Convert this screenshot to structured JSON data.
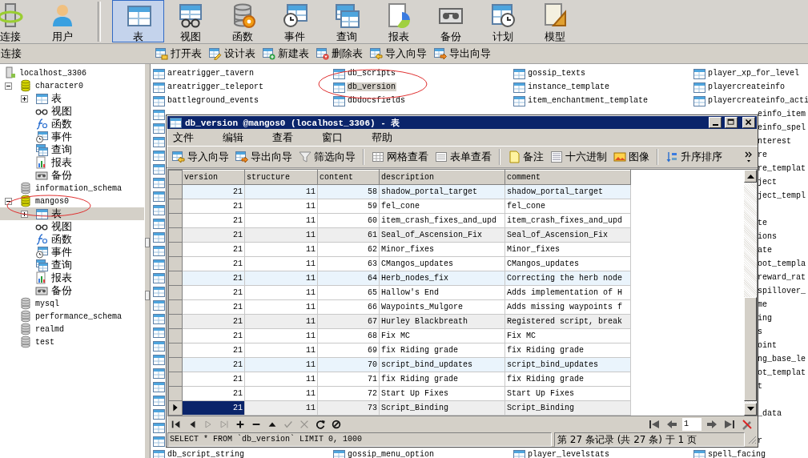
{
  "toolbar": [
    [
      {
        "label": "连接",
        "kind": "connection",
        "selected": false
      },
      {
        "label": "用户",
        "kind": "user",
        "selected": false
      }
    ],
    [
      {
        "label": "表",
        "kind": "table",
        "selected": true
      },
      {
        "label": "视图",
        "kind": "view",
        "selected": false
      },
      {
        "label": "函数",
        "kind": "function",
        "selected": false
      },
      {
        "label": "事件",
        "kind": "event",
        "selected": false
      },
      {
        "label": "查询",
        "kind": "query",
        "selected": false
      },
      {
        "label": "报表",
        "kind": "report",
        "selected": false
      },
      {
        "label": "备份",
        "kind": "backup",
        "selected": false
      },
      {
        "label": "计划",
        "kind": "schedule",
        "selected": false
      },
      {
        "label": "模型",
        "kind": "model",
        "selected": false
      }
    ]
  ],
  "panel_title": "连接",
  "actions": [
    {
      "label": "打开表",
      "kind": "open"
    },
    {
      "label": "设计表",
      "kind": "design"
    },
    {
      "label": "新建表",
      "kind": "new"
    },
    {
      "label": "删除表",
      "kind": "delete"
    },
    {
      "label": "导入向导",
      "kind": "import"
    },
    {
      "label": "导出向导",
      "kind": "export"
    }
  ],
  "tree": [
    {
      "label": "localhost_3306",
      "kind": "server",
      "selected": false,
      "children": [
        {
          "label": "character0",
          "kind": "database",
          "expanded": true,
          "selected": false,
          "children": [
            {
              "label": "表",
              "kind": "tables",
              "expanded": false,
              "selected": false
            },
            {
              "label": "视图",
              "kind": "views",
              "selected": false
            },
            {
              "label": "函数",
              "kind": "functions",
              "selected": false
            },
            {
              "label": "事件",
              "kind": "events",
              "selected": false
            },
            {
              "label": "查询",
              "kind": "queries",
              "selected": false
            },
            {
              "label": "报表",
              "kind": "reports",
              "selected": false
            },
            {
              "label": "备份",
              "kind": "backups",
              "selected": false
            }
          ]
        },
        {
          "label": "information_schema",
          "kind": "database",
          "selected": false
        },
        {
          "label": "mangos0",
          "kind": "database",
          "expanded": true,
          "selected": false,
          "children": [
            {
              "label": "表",
              "kind": "tables",
              "expanded": false,
              "selected": true
            },
            {
              "label": "视图",
              "kind": "views",
              "selected": false
            },
            {
              "label": "函数",
              "kind": "functions",
              "selected": false
            },
            {
              "label": "事件",
              "kind": "events",
              "selected": false
            },
            {
              "label": "查询",
              "kind": "queries",
              "selected": false
            },
            {
              "label": "报表",
              "kind": "reports",
              "selected": false
            },
            {
              "label": "备份",
              "kind": "backups",
              "selected": false
            }
          ]
        },
        {
          "label": "mysql",
          "kind": "database",
          "selected": false
        },
        {
          "label": "performance_schema",
          "kind": "database",
          "selected": false
        },
        {
          "label": "realmd",
          "kind": "database",
          "selected": false
        },
        {
          "label": "test",
          "kind": "database",
          "selected": false
        }
      ]
    }
  ],
  "objects": {
    "rows": [
      [
        {
          "name": "areatrigger_tavern",
          "selected": false
        },
        {
          "name": "db_scripts",
          "selected": false
        },
        {
          "name": "gossip_texts",
          "selected": false
        },
        {
          "name": "player_xp_for_level",
          "selected": false
        }
      ],
      [
        {
          "name": "areatrigger_teleport",
          "selected": false
        },
        {
          "name": "db_version",
          "selected": true
        },
        {
          "name": "instance_template",
          "selected": false
        },
        {
          "name": "playercreateinfo",
          "selected": false
        }
      ],
      [
        {
          "name": "battleground_events",
          "selected": false
        },
        {
          "name": "dbdocsfields",
          "selected": false
        },
        {
          "name": "item_enchantment_template",
          "selected": false
        },
        {
          "name": "playercreateinfo_acti",
          "selected": false
        }
      ]
    ],
    "right_fragment_groups": [
      [
        "einfo_item",
        "einfo_spel",
        "nterest",
        "re",
        "re_templat",
        "ject",
        "ject_templ"
      ],
      [
        "te",
        "ions",
        "ate",
        "oot_templa",
        "reward_rat",
        "spillover_",
        "me",
        "ing",
        "s",
        "oint",
        "ng_base_le",
        "ot_templat",
        "t"
      ],
      [
        "_data"
      ],
      [
        "r"
      ]
    ],
    "bottom_row": [
      "db_script_string",
      "gossip_menu_option",
      "player_levelstats",
      "spell_facing"
    ]
  },
  "window": {
    "title": "db_version @mangos0 (localhost_3306) - 表",
    "menu": [
      "文件",
      "编辑",
      "查看",
      "窗口",
      "帮助"
    ],
    "toolbar": [
      [
        {
          "label": "导入向导",
          "kind": "import"
        },
        {
          "label": "导出向导",
          "kind": "export"
        },
        {
          "label": "筛选向导",
          "kind": "filter"
        }
      ],
      [
        {
          "label": "网格查看",
          "kind": "grid"
        },
        {
          "label": "表单查看",
          "kind": "form"
        }
      ],
      [
        {
          "label": "备注",
          "kind": "note"
        },
        {
          "label": "十六进制",
          "kind": "hex"
        },
        {
          "label": "图像",
          "kind": "image"
        }
      ],
      [
        {
          "label": "升序排序",
          "kind": "sort"
        }
      ]
    ],
    "columns": [
      "version",
      "structure",
      "content",
      "description",
      "comment"
    ],
    "rows": [
      {
        "cells": [
          "21",
          "11",
          "58",
          "shadow_portal_target",
          "shadow_portal_target"
        ],
        "color": "#eaf4fc",
        "selected": false
      },
      {
        "cells": [
          "21",
          "11",
          "59",
          "fel_cone",
          "fel_cone"
        ],
        "color": "#ffffff",
        "selected": false
      },
      {
        "cells": [
          "21",
          "11",
          "60",
          "item_crash_fixes_and_upd",
          "item_crash_fixes_and_upd"
        ],
        "color": "#ffffff",
        "selected": false
      },
      {
        "cells": [
          "21",
          "11",
          "61",
          "Seal_of_Ascension_Fix",
          "Seal_of_Ascension_Fix"
        ],
        "color": "#eeeeee",
        "selected": false
      },
      {
        "cells": [
          "21",
          "11",
          "62",
          "Minor_fixes",
          "Minor_fixes"
        ],
        "color": "#ffffff",
        "selected": false
      },
      {
        "cells": [
          "21",
          "11",
          "63",
          "CMangos_updates",
          "CMangos_updates"
        ],
        "color": "#ffffff",
        "selected": false
      },
      {
        "cells": [
          "21",
          "11",
          "64",
          "Herb_nodes_fix",
          "Correcting the herb node"
        ],
        "color": "#eaf4fc",
        "selected": false
      },
      {
        "cells": [
          "21",
          "11",
          "65",
          "Hallow's End",
          "Adds implementation of H"
        ],
        "color": "#ffffff",
        "selected": false
      },
      {
        "cells": [
          "21",
          "11",
          "66",
          "Waypoints_Mulgore",
          "Adds missing waypoints f"
        ],
        "color": "#ffffff",
        "selected": false
      },
      {
        "cells": [
          "21",
          "11",
          "67",
          "Hurley Blackbreath",
          "Registered script, break"
        ],
        "color": "#eeeeee",
        "selected": false
      },
      {
        "cells": [
          "21",
          "11",
          "68",
          "Fix MC",
          "Fix MC"
        ],
        "color": "#ffffff",
        "selected": false
      },
      {
        "cells": [
          "21",
          "11",
          "69",
          "fix Riding grade",
          "fix Riding grade"
        ],
        "color": "#ffffff",
        "selected": false
      },
      {
        "cells": [
          "21",
          "11",
          "70",
          "script_bind_updates",
          "script_bind_updates"
        ],
        "color": "#eaf4fc",
        "selected": false
      },
      {
        "cells": [
          "21",
          "11",
          "71",
          "fix Riding grade",
          "fix Riding grade"
        ],
        "color": "#ffffff",
        "selected": false
      },
      {
        "cells": [
          "21",
          "11",
          "72",
          "Start Up Fixes",
          "Start Up Fixes"
        ],
        "color": "#ffffff",
        "selected": false
      },
      {
        "cells": [
          "21",
          "11",
          "73",
          "Script_Binding",
          "Script_Binding"
        ],
        "color": "#eeeeee",
        "selected": true
      }
    ],
    "nav": [
      {
        "kind": "first",
        "disabled": false
      },
      {
        "kind": "prev",
        "disabled": false
      },
      {
        "kind": "next",
        "disabled": true
      },
      {
        "kind": "last",
        "disabled": true
      },
      {
        "kind": "add",
        "disabled": false
      },
      {
        "kind": "delete",
        "disabled": false
      },
      {
        "kind": "up",
        "disabled": false
      },
      {
        "kind": "apply",
        "disabled": true
      },
      {
        "kind": "cancel",
        "disabled": true
      },
      {
        "kind": "refresh",
        "disabled": false
      },
      {
        "kind": "stop",
        "disabled": false
      }
    ],
    "pager": {
      "before": [
        {
          "kind": "page_first"
        },
        {
          "kind": "page_prev"
        }
      ],
      "value": "1",
      "after": [
        {
          "kind": "page_next"
        },
        {
          "kind": "page_last"
        }
      ]
    },
    "sql": "SELECT * FROM `db_version` LIMIT 0, 1000",
    "record_info": "第 27 条记录 (共 27 条) 于 1 页"
  }
}
